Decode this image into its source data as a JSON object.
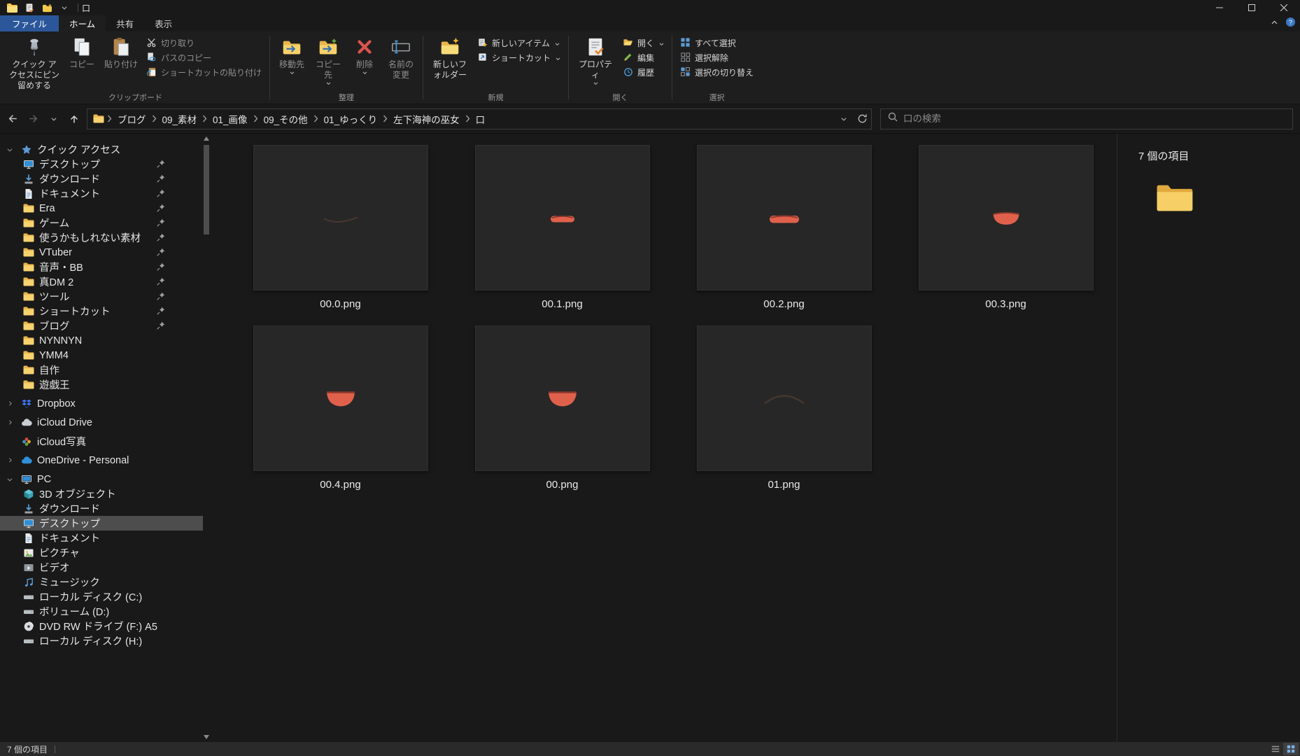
{
  "window_title": "口",
  "ribbon": {
    "file_tab": "ファイル",
    "tabs": [
      {
        "label": "ホーム",
        "selected": true
      },
      {
        "label": "共有",
        "selected": false
      },
      {
        "label": "表示",
        "selected": false
      }
    ],
    "clipboard": {
      "group_label": "クリップボード",
      "pin_to_quick_access": "クイック アクセスにピン留めする",
      "copy": "コピー",
      "paste": "貼り付け",
      "cut": "切り取り",
      "copy_path": "パスのコピー",
      "paste_shortcut": "ショートカットの貼り付け"
    },
    "organize": {
      "group_label": "整理",
      "move_to": "移動先",
      "copy_to": "コピー先",
      "delete": "削除",
      "rename": "名前の変更"
    },
    "new": {
      "group_label": "新規",
      "new_folder": "新しいフォルダー",
      "new_item": "新しいアイテム",
      "shortcut": "ショートカット"
    },
    "open": {
      "group_label": "開く",
      "properties": "プロパティ",
      "open": "開く",
      "edit": "編集",
      "history": "履歴"
    },
    "select": {
      "group_label": "選択",
      "select_all": "すべて選択",
      "select_none": "選択解除",
      "invert_selection": "選択の切り替え"
    }
  },
  "address": {
    "breadcrumbs": [
      "ブログ",
      "09_素材",
      "01_画像",
      "09_その他",
      "01_ゆっくり",
      "左下海神の巫女",
      "口"
    ],
    "search_placeholder": "口の検索"
  },
  "sidebar": {
    "items": [
      {
        "id": "quick-access",
        "label": "クイック アクセス",
        "icon": "star",
        "level": 0,
        "expander": "down"
      },
      {
        "id": "desktop-pinned",
        "label": "デスクトップ",
        "icon": "desktop",
        "level": 1,
        "pinned": true
      },
      {
        "id": "downloads-pinned",
        "label": "ダウンロード",
        "icon": "download",
        "level": 1,
        "pinned": true
      },
      {
        "id": "documents-pinned",
        "label": "ドキュメント",
        "icon": "document",
        "level": 1,
        "pinned": true
      },
      {
        "id": "era",
        "label": "Era",
        "icon": "folder",
        "level": 1,
        "pinned": true
      },
      {
        "id": "game",
        "label": "ゲーム",
        "icon": "folder",
        "level": 1,
        "pinned": true
      },
      {
        "id": "maybe-materials",
        "label": "使うかもしれない素材",
        "icon": "folder",
        "level": 1,
        "pinned": true
      },
      {
        "id": "vtuber",
        "label": "VTuber",
        "icon": "folder",
        "level": 1,
        "pinned": true
      },
      {
        "id": "onsei-bb",
        "label": "音声・BB",
        "icon": "folder",
        "level": 1,
        "pinned": true
      },
      {
        "id": "shin-dm2",
        "label": "真DM 2",
        "icon": "folder",
        "level": 1,
        "pinned": true
      },
      {
        "id": "tools",
        "label": "ツール",
        "icon": "folder",
        "level": 1,
        "pinned": true
      },
      {
        "id": "shortcuts",
        "label": "ショートカット",
        "icon": "folder",
        "level": 1,
        "pinned": true
      },
      {
        "id": "blog",
        "label": "ブログ",
        "icon": "folder",
        "level": 1,
        "pinned": true
      },
      {
        "id": "nynnyn",
        "label": "NYNNYN",
        "icon": "folder",
        "level": 1
      },
      {
        "id": "ymm4",
        "label": "YMM4",
        "icon": "folder",
        "level": 1
      },
      {
        "id": "jisaku",
        "label": "自作",
        "icon": "folder",
        "level": 1
      },
      {
        "id": "yugioh",
        "label": "遊戯王",
        "icon": "folder",
        "level": 1
      },
      {
        "id": "dropbox",
        "label": "Dropbox",
        "icon": "dropbox",
        "level": 0,
        "expander": "right",
        "gap": true
      },
      {
        "id": "icloud-drive",
        "label": "iCloud Drive",
        "icon": "cloud",
        "level": 0,
        "expander": "right",
        "gap": true
      },
      {
        "id": "icloud-photos",
        "label": "iCloud写真",
        "icon": "photos",
        "level": 0,
        "gap": true
      },
      {
        "id": "onedrive",
        "label": "OneDrive - Personal",
        "icon": "onedrive",
        "level": 0,
        "expander": "right",
        "gap": true
      },
      {
        "id": "pc",
        "label": "PC",
        "icon": "pc",
        "level": 0,
        "expander": "down",
        "gap": true
      },
      {
        "id": "3d-objects",
        "label": "3D オブジェクト",
        "icon": "cube3d",
        "level": 1
      },
      {
        "id": "downloads",
        "label": "ダウンロード",
        "icon": "download",
        "level": 1
      },
      {
        "id": "desktop",
        "label": "デスクトップ",
        "icon": "desktop",
        "level": 1,
        "selected": true
      },
      {
        "id": "documents",
        "label": "ドキュメント",
        "icon": "document",
        "level": 1
      },
      {
        "id": "pictures",
        "label": "ピクチャ",
        "icon": "pictures",
        "level": 1
      },
      {
        "id": "videos",
        "label": "ビデオ",
        "icon": "videos",
        "level": 1
      },
      {
        "id": "music",
        "label": "ミュージック",
        "icon": "music",
        "level": 1
      },
      {
        "id": "local-disk-c",
        "label": "ローカル ディスク (C:)",
        "icon": "drive",
        "level": 1
      },
      {
        "id": "volume-d",
        "label": "ボリューム (D:)",
        "icon": "drive",
        "level": 1
      },
      {
        "id": "dvd-rw-f",
        "label": "DVD RW ドライブ (F:) A5",
        "icon": "dvd",
        "level": 1
      },
      {
        "id": "local-disk-h",
        "label": "ローカル ディスク (H:)",
        "icon": "drive",
        "level": 1
      }
    ]
  },
  "files": [
    {
      "name": "00.0.png",
      "shape": "thin-line"
    },
    {
      "name": "00.1.png",
      "shape": "mouth-closed-small"
    },
    {
      "name": "00.2.png",
      "shape": "mouth-closed"
    },
    {
      "name": "00.3.png",
      "shape": "mouth-open-small"
    },
    {
      "name": "00.4.png",
      "shape": "mouth-open"
    },
    {
      "name": "00.png",
      "shape": "mouth-open"
    },
    {
      "name": "01.png",
      "shape": "arc"
    }
  ],
  "preview_pane": {
    "items_count": "7 個の項目"
  },
  "status_bar": {
    "items_count": "7 個の項目"
  },
  "icons": [
    "explorer-app",
    "properties",
    "new-folder",
    "chevron-down",
    "minimize",
    "maximize",
    "close",
    "chevron-up",
    "help",
    "pin",
    "copy",
    "paste",
    "cut",
    "copy-path",
    "paste-shortcut",
    "move-to",
    "copy-to",
    "delete",
    "rename",
    "new-item",
    "shortcut",
    "open",
    "edit",
    "history",
    "select-all",
    "select-none",
    "invert-selection",
    "back-arrow",
    "forward-arrow",
    "up-arrow",
    "refresh",
    "search",
    "folder",
    "star",
    "desktop",
    "download",
    "document",
    "pictures",
    "videos",
    "music",
    "pc",
    "3d-cube",
    "drive",
    "dvd",
    "dropbox",
    "cloud",
    "onedrive",
    "photos",
    "view-details",
    "view-icons"
  ],
  "colors": {
    "accent_blue": "#2b579a",
    "folder_yellow": "#f2c94c",
    "mouth_red": "#e0614b",
    "selection_gray": "#4d4d4d",
    "background": "#191919"
  }
}
